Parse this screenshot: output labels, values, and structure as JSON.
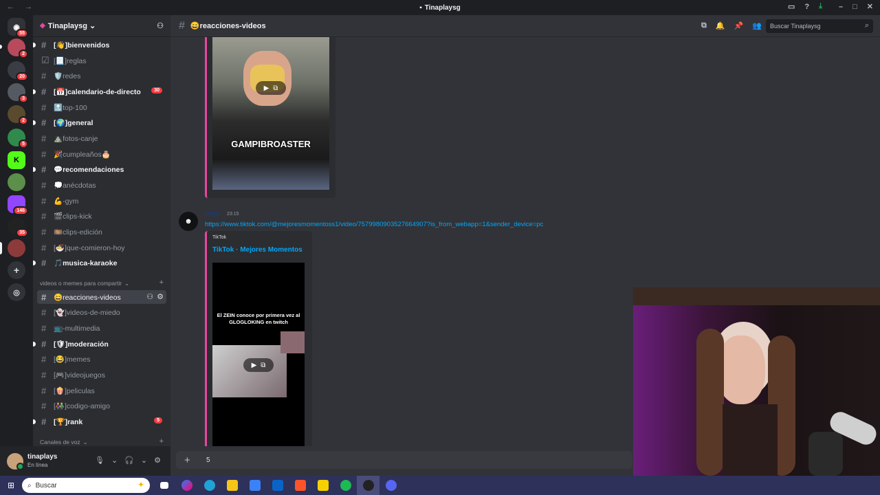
{
  "window": {
    "title": "Tinaplaysg"
  },
  "servers": {
    "badges": [
      "55",
      "2",
      "20",
      "3",
      "2",
      "5",
      "146",
      "35"
    ]
  },
  "guild": {
    "name": "Tinaplaysg"
  },
  "channels": [
    {
      "label": "[👋]bienvenidos",
      "unread": true
    },
    {
      "label": "[📃]reglas",
      "unread": false
    },
    {
      "label": "🛡️redes",
      "unread": false
    },
    {
      "label": "[📅]calendario-de-directo",
      "unread": true,
      "mentions": "30"
    },
    {
      "label": "🔝top-100",
      "unread": false
    },
    {
      "label": "[🌍]general",
      "unread": true
    },
    {
      "label": "⛰️fotos-canje",
      "unread": false
    },
    {
      "label": "🎉cumpleaños🎂",
      "unread": false
    },
    {
      "label": "💬recomendaciones",
      "unread": true
    },
    {
      "label": "💭anécdotas",
      "unread": false
    },
    {
      "label": "💪-gym",
      "unread": false
    },
    {
      "label": "🎬clips-kick",
      "unread": false
    },
    {
      "label": "🎞️clips-edición",
      "unread": false
    },
    {
      "label": "[🍜]que-comieron-hoy",
      "unread": false
    },
    {
      "label": "🎵musica-karaoke",
      "unread": true
    }
  ],
  "category1": {
    "label": "videos o memes para compartir"
  },
  "channels2": [
    {
      "label": "😄reacciones-videos",
      "active": true
    },
    {
      "label": "[👻]videos-de-miedo",
      "unread": false
    },
    {
      "label": "📺-multimedia",
      "unread": false
    },
    {
      "label": "[🛡]moderación",
      "unread": true
    },
    {
      "label": "[😂]memes",
      "unread": false
    },
    {
      "label": "[🎮]videojuegos",
      "unread": false
    },
    {
      "label": "[🍿]peliculas",
      "unread": false
    },
    {
      "label": "[👫]codigo-amigo",
      "unread": false
    },
    {
      "label": "[🏆]rank",
      "unread": true,
      "mentions": "5"
    }
  ],
  "category2": {
    "label": "Canales de voz"
  },
  "user": {
    "name": "tinaplays",
    "status": "En línea"
  },
  "header": {
    "channel": "😄reacciones-videos",
    "search_placeholder": "Buscar Tinaplaysg"
  },
  "message1": {
    "caption": "GAMPIBROASTER"
  },
  "message2": {
    "author": "Differ",
    "time": "23:15",
    "link": "https://www.tiktok.com/@mejoresmomentoss1/video/7579980903527664907?is_from_webapp=1&sender_device=pc",
    "provider": "TikTok",
    "embed_title": "TikTok · Mejores Momentos",
    "video_text": "El ZEIN conoce por primera vez al GLOGLOKING en twitch"
  },
  "composer": {
    "value": "5"
  },
  "taskbar": {
    "search": "Buscar"
  },
  "colors": {
    "accent": "#eb459e",
    "link": "#00a8fc",
    "mention": "#f23f43",
    "online": "#23a55a"
  }
}
